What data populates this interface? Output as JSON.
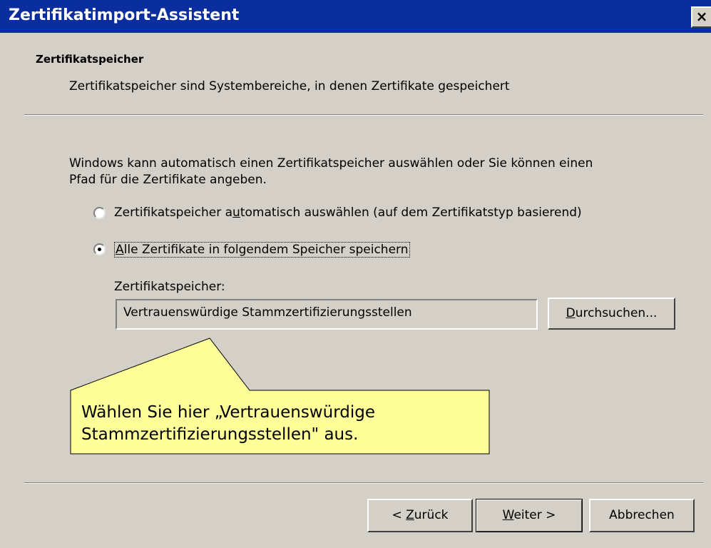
{
  "window": {
    "title": "Zertifikatimport-Assistent",
    "close_symbol": "×"
  },
  "header": {
    "title": "Zertifikatspeicher",
    "subtitle": "Zertifikatspeicher sind Systembereiche, in denen Zertifikate gespeichert"
  },
  "body": {
    "intro_line1": "Windows kann automatisch einen Zertifikatspeicher auswählen oder Sie können einen",
    "intro_line2": "Pfad für die Zertifikate angeben.",
    "radio_auto": {
      "label_pre": "Zertifikatspeicher a",
      "label_key": "u",
      "label_post": "tomatisch auswählen (auf dem Zertifikatstyp basierend)",
      "selected": false
    },
    "radio_manual": {
      "label_key": "A",
      "label_post": "lle Zertifikate in folgendem Speicher speichern",
      "selected": true
    },
    "store_label": "Zertifikatspeicher:",
    "store_value": "Vertrauenswürdige Stammzertifizierungsstellen",
    "browse": {
      "key": "D",
      "rest": "urchsuchen..."
    }
  },
  "callout": {
    "line1": "Wählen Sie hier „Vertrauenswürdige",
    "line2": "Stammzertifizierungsstellen\" aus.",
    "fill": "#ffff99"
  },
  "footer": {
    "back": {
      "pre": "< ",
      "key": "Z",
      "rest": "urück"
    },
    "next": {
      "key": "W",
      "rest": "eiter >"
    },
    "cancel": "Abbrechen"
  },
  "colors": {
    "titlebar": "#0b2e9e",
    "dialog_bg": "#d4d0c8"
  }
}
